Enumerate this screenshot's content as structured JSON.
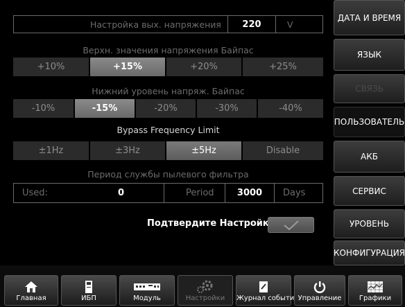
{
  "output_voltage": {
    "label": "Настройка вых. напряжения",
    "value": "220",
    "unit": "V"
  },
  "bypass_upper": {
    "title": "Верхн. значения напряжения Байпас",
    "options": [
      "+10%",
      "+15%",
      "+20%",
      "+25%"
    ],
    "selected": "+15%"
  },
  "bypass_lower": {
    "title": "Нижний уровень напряж. Байпас",
    "options": [
      "-10%",
      "-15%",
      "-20%",
      "-30%",
      "-40%"
    ],
    "selected": "-15%"
  },
  "bypass_freq": {
    "title": "Bypass Frequency Limit",
    "options": [
      "±1Hz",
      "±3Hz",
      "±5Hz",
      "Disable"
    ],
    "selected": "±5Hz"
  },
  "dust_filter": {
    "title": "Период службы пылевого фильтра",
    "used_label": "Used:",
    "used_value": "0",
    "period_label": "Period",
    "period_value": "3000",
    "unit": "Days"
  },
  "confirm": {
    "label": "Подтвердите Настройки"
  },
  "sidebar": {
    "items": [
      {
        "label": "ДАТА И ВРЕМЯ",
        "state": "normal"
      },
      {
        "label": "ЯЗЫК",
        "state": "normal"
      },
      {
        "label": "СВЯЗЬ",
        "state": "disabled"
      },
      {
        "label": "ПОЛЬЗОВАТЕЛЬ",
        "state": "active"
      },
      {
        "label": "АКБ",
        "state": "normal"
      },
      {
        "label": "СЕРВИС",
        "state": "normal"
      },
      {
        "label": "УРОВЕНЬ",
        "state": "normal"
      },
      {
        "label": "КОНФИГУРАЦИЯ",
        "state": "normal"
      }
    ]
  },
  "bottom_nav": {
    "tabs": [
      {
        "label": "Главная",
        "icon": "home-icon"
      },
      {
        "label": "ИБП",
        "icon": "ups-icon"
      },
      {
        "label": "Модуль",
        "icon": "module-icon"
      },
      {
        "label": "Настройки",
        "icon": "gears-icon",
        "active": true
      },
      {
        "label": "Журнал событий",
        "icon": "event-log-icon"
      },
      {
        "label": "Управление",
        "icon": "power-icon"
      },
      {
        "label": "Графики",
        "icon": "chart-icon"
      }
    ]
  },
  "colors": {
    "background": "#000000",
    "panel_border": "#6c6c6c",
    "selected": "#7a7a7a",
    "sidebar_gradient_top": "#3c3c3c"
  }
}
